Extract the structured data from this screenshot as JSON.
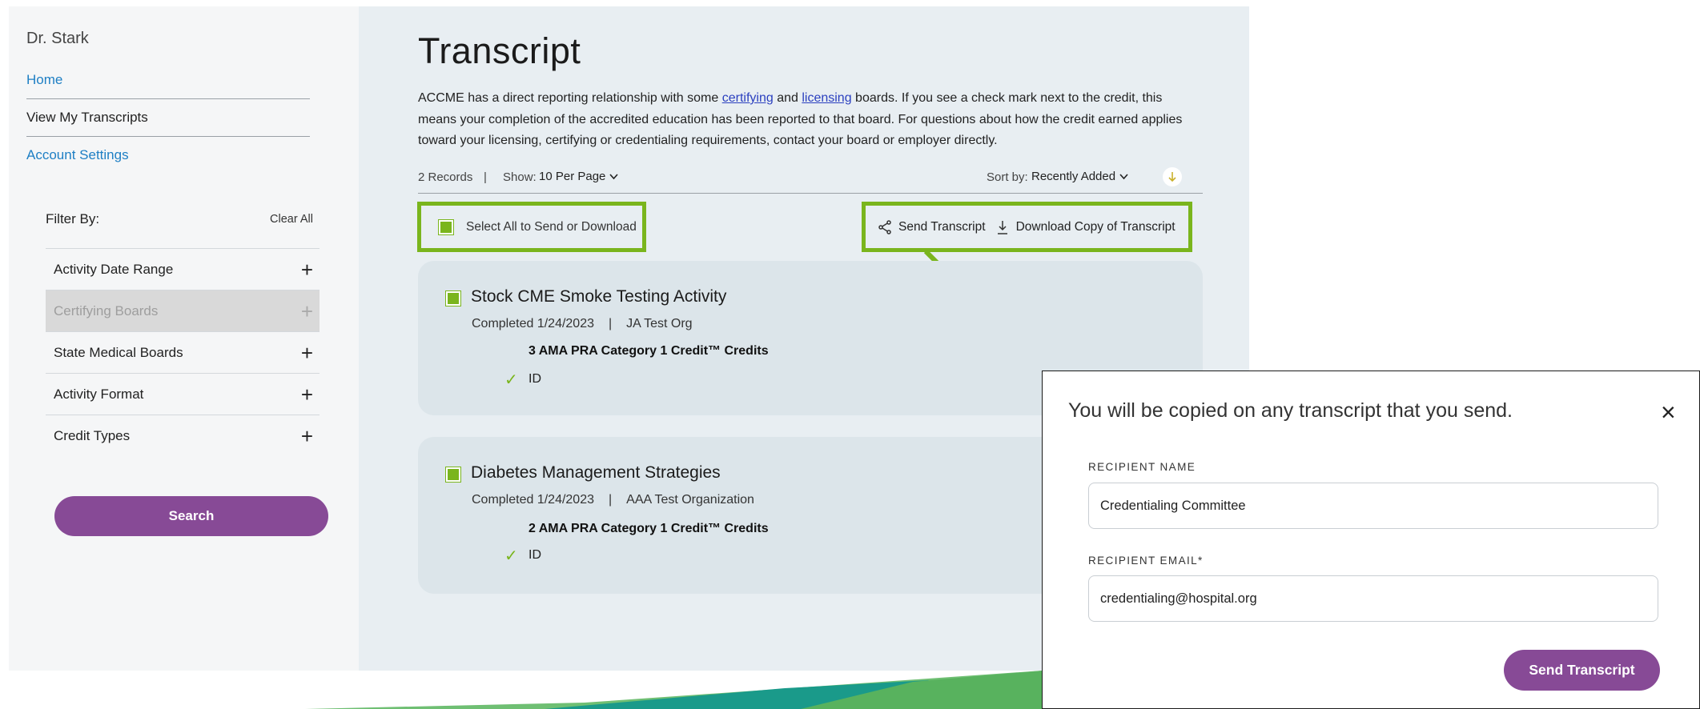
{
  "sidebar": {
    "user_name": "Dr. Stark",
    "nav": {
      "home": "Home",
      "transcripts": "View My Transcripts",
      "account": "Account Settings"
    },
    "filter_label": "Filter By:",
    "clear_all": "Clear All",
    "filters": [
      {
        "label": "Activity Date Range",
        "disabled": false
      },
      {
        "label": "Certifying Boards",
        "disabled": true
      },
      {
        "label": "State Medical Boards",
        "disabled": false
      },
      {
        "label": "Activity Format",
        "disabled": false
      },
      {
        "label": "Credit Types",
        "disabled": false
      }
    ],
    "plus_icon": "+",
    "search_button": "Search"
  },
  "main": {
    "title": "Transcript",
    "intro": {
      "part1": "ACCME has a direct reporting relationship with some ",
      "link1": "certifying",
      "part2": " and ",
      "link2": "licensing",
      "part3": " boards. If you see a check mark next to the credit, this means your completion of the accredited education has been reported to that board. For questions about how the credit earned applies toward your licensing, certifying or credentialing requirements, contact your board or employer directly."
    },
    "records": "2 Records",
    "separator": "|",
    "show_label": "Show:",
    "show_value": "10 Per Page",
    "sort_label": "Sort by:",
    "sort_value": "Recently Added",
    "select_all": "Select All to Send or Download",
    "send_transcript": "Send Transcript",
    "download_transcript": "Download Copy of Transcript",
    "activities": [
      {
        "title": "Stock CME Smoke Testing Activity",
        "completed": "Completed 1/24/2023",
        "org": "JA Test Org",
        "credits": "3 AMA PRA Category 1 Credit™ Credits",
        "board": "ID"
      },
      {
        "title": "Diabetes Management Strategies",
        "completed": "Completed 1/24/2023",
        "org": "AAA Test Organization",
        "credits": "2 AMA PRA Category 1 Credit™ Credits",
        "board": "ID"
      }
    ]
  },
  "modal": {
    "message": "You will be copied on any transcript that you send.",
    "close_icon": "×",
    "recipient_name_label": "RECIPIENT NAME",
    "recipient_name_value": "Credentialing Committee",
    "recipient_email_label": "RECIPIENT EMAIL*",
    "recipient_email_value": "credentialing@hospital.org",
    "send_button": "Send Transcript"
  },
  "colors": {
    "accent_green": "#7ab51d",
    "button_purple": "#874a96",
    "link_blue": "#1e7fc4"
  },
  "icons": [
    "chevron-down-icon",
    "download-arrow-icon",
    "share-icon",
    "download-icon",
    "checkmark-icon",
    "close-icon",
    "plus-icon"
  ]
}
